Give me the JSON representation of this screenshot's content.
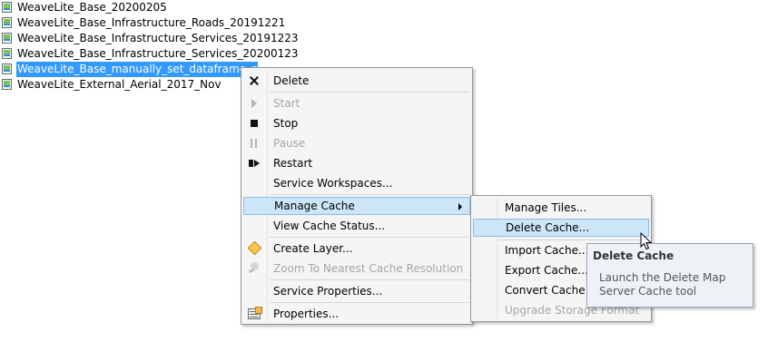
{
  "services": [
    {
      "label": "WeaveLite_Base_20200205",
      "selected": false
    },
    {
      "label": "WeaveLite_Base_Infrastructure_Roads_20191221",
      "selected": false
    },
    {
      "label": "WeaveLite_Base_Infrastructure_Services_20191223",
      "selected": false
    },
    {
      "label": "WeaveLite_Base_Infrastructure_Services_20200123",
      "selected": false
    },
    {
      "label": "WeaveLite_Base_manually_set_dataframe_prop...",
      "selected": true
    },
    {
      "label": "WeaveLite_External_Aerial_2017_Nov",
      "selected": false
    }
  ],
  "context_menu": {
    "items": [
      {
        "label": "Delete",
        "icon": "delete-x-icon",
        "disabled": false
      },
      {
        "label": "Start",
        "icon": "play-icon",
        "disabled": true
      },
      {
        "label": "Stop",
        "icon": "stop-icon",
        "disabled": false
      },
      {
        "label": "Pause",
        "icon": "pause-icon",
        "disabled": true
      },
      {
        "label": "Restart",
        "icon": "restart-icon",
        "disabled": false
      },
      {
        "label": "Service Workspaces...",
        "icon": "",
        "disabled": false
      },
      {
        "label": "Manage Cache",
        "icon": "",
        "disabled": false,
        "highlighted": true,
        "has_submenu": true
      },
      {
        "label": "View Cache Status...",
        "icon": "",
        "disabled": false
      },
      {
        "label": "Create Layer...",
        "icon": "diamond-layer-icon",
        "disabled": false
      },
      {
        "label": "Zoom To Nearest Cache Resolution",
        "icon": "zoom-icon",
        "disabled": true
      },
      {
        "label": "Service Properties...",
        "icon": "",
        "disabled": false
      },
      {
        "label": "Properties...",
        "icon": "properties-icon",
        "disabled": false
      }
    ]
  },
  "submenu": {
    "items": [
      {
        "label": "Manage Tiles...",
        "disabled": false
      },
      {
        "label": "Delete Cache...",
        "disabled": false,
        "highlighted": true
      },
      {
        "label": "Import Cache...",
        "disabled": false
      },
      {
        "label": "Export Cache...",
        "disabled": false
      },
      {
        "label": "Convert Cache Fo",
        "disabled": false
      },
      {
        "label": "Upgrade Storage Format",
        "disabled": true
      }
    ]
  },
  "tooltip": {
    "title": "Delete Cache",
    "body": "Launch the Delete Map Server Cache tool"
  },
  "colors": {
    "selection": "#3399ff",
    "menu_highlight": "#cde6f7",
    "menu_background": "#f5f5f5",
    "disabled_text": "#a6a6a6"
  }
}
